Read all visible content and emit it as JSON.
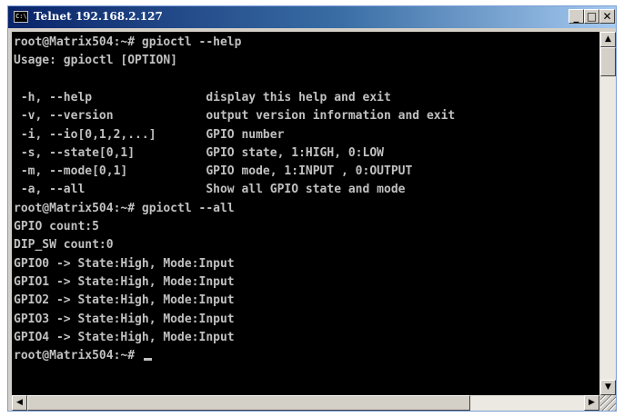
{
  "window": {
    "title": "Telnet 192.168.2.127",
    "icon_text": "C:\\",
    "controls": {
      "minimize": "_",
      "maximize": "□",
      "close": "✕"
    }
  },
  "terminal": {
    "lines": [
      "root@Matrix504:~# gpioctl --help",
      "Usage: gpioctl [OPTION]",
      "",
      " -h, --help                display this help and exit",
      " -v, --version             output version information and exit",
      " -i, --io[0,1,2,...]       GPIO number",
      " -s, --state[0,1]          GPIO state, 1:HIGH, 0:LOW",
      " -m, --mode[0,1]           GPIO mode, 1:INPUT , 0:OUTPUT",
      " -a, --all                 Show all GPIO state and mode",
      "root@Matrix504:~# gpioctl --all",
      "GPIO count:5",
      "DIP_SW count:0",
      "GPIO0 -> State:High, Mode:Input",
      "GPIO1 -> State:High, Mode:Input",
      "GPIO2 -> State:High, Mode:Input",
      "GPIO3 -> State:High, Mode:Input",
      "GPIO4 -> State:High, Mode:Input",
      "root@Matrix504:~# "
    ],
    "colors": {
      "background": "#000000",
      "foreground": "#c0c0c0"
    }
  },
  "scrollbars": {
    "up": "▲",
    "down": "▼",
    "left": "◀",
    "right": "▶"
  }
}
